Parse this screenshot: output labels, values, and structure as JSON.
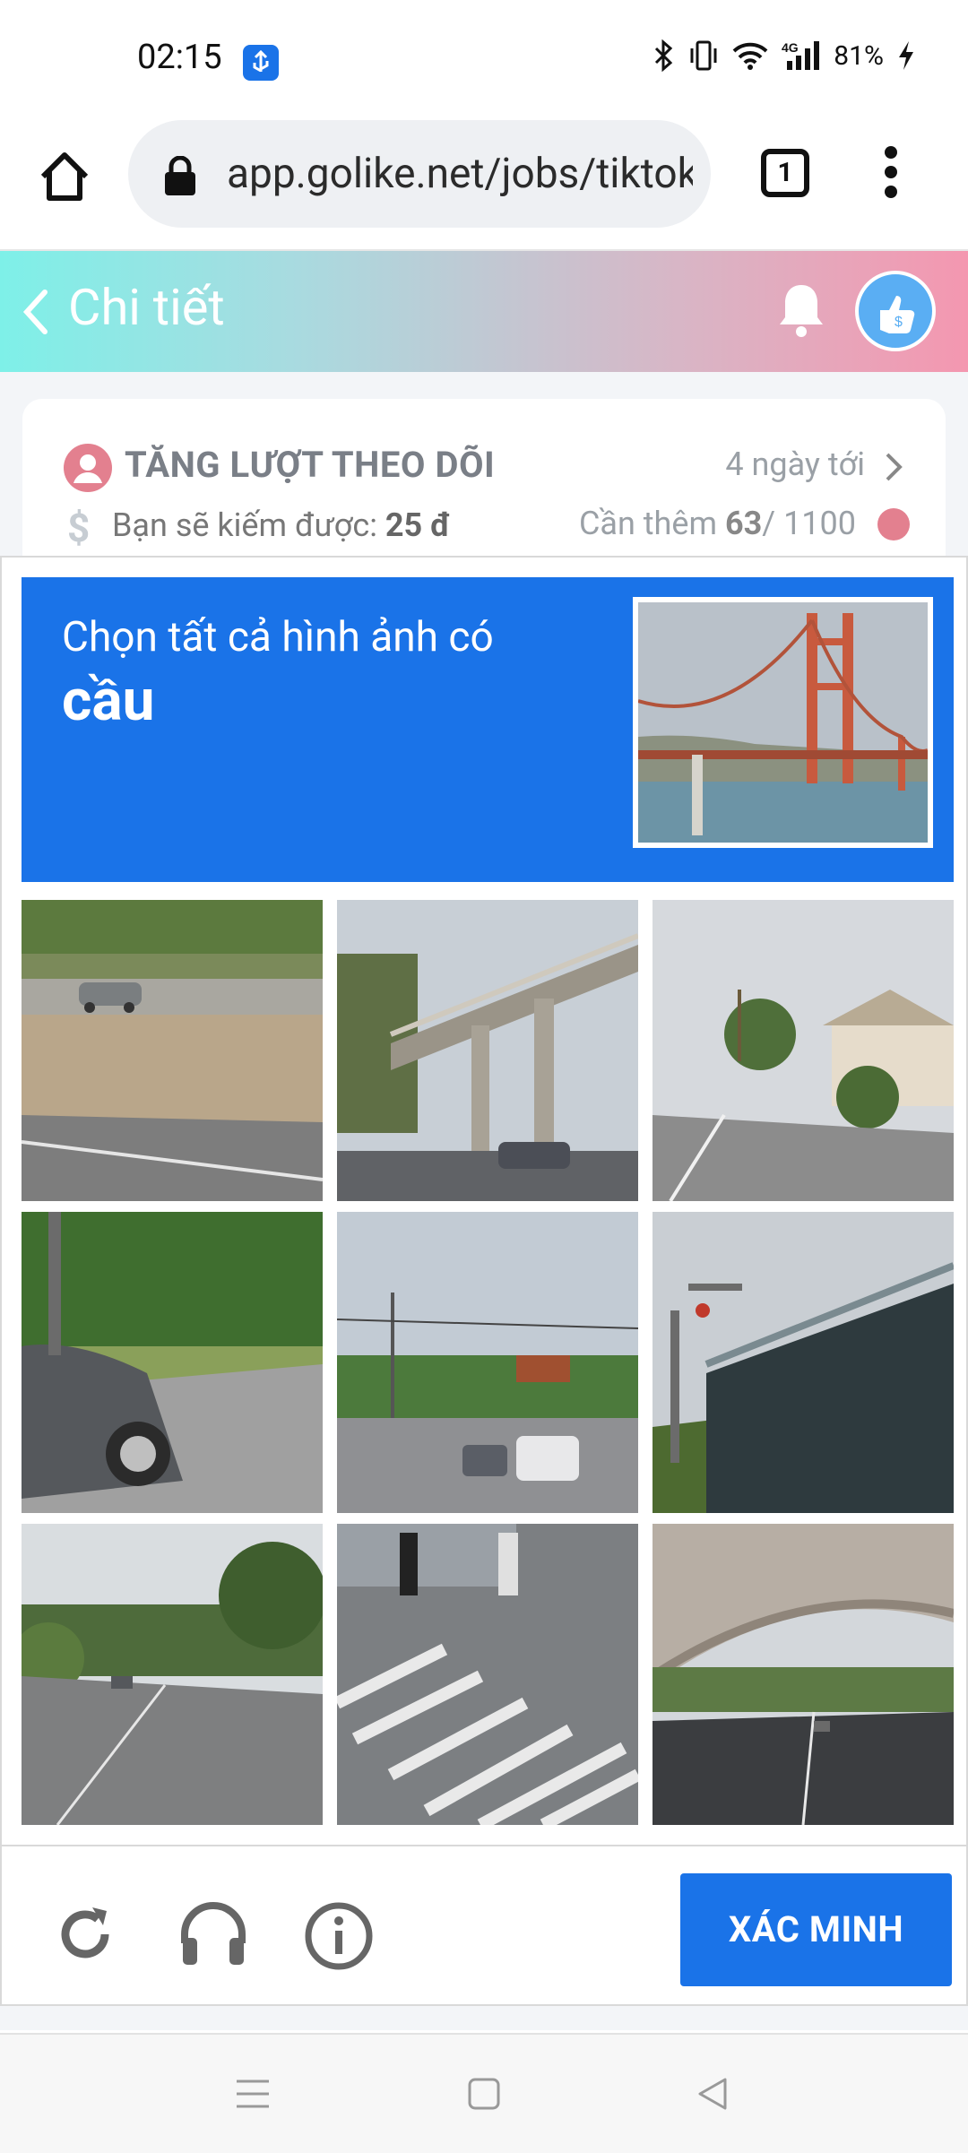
{
  "status_bar": {
    "time": "02:15",
    "battery_text": "81%",
    "network": "4G",
    "icons": [
      "usb-icon",
      "bluetooth-icon",
      "vibrate-icon",
      "wifi-icon",
      "signal-icon",
      "battery-charging-icon"
    ]
  },
  "browser": {
    "url": "app.golike.net/jobs/tiktok",
    "tab_count": "1"
  },
  "header": {
    "title": "Chi tiết"
  },
  "job": {
    "title": "TĂNG LƯỢT THEO DÕI",
    "deadline": "4 ngày tới",
    "earn_label": "Bạn sẽ kiếm được: ",
    "earn_value": "25 đ",
    "need_label": "Cần thêm ",
    "need_value": "63",
    "need_total": "/ 1100"
  },
  "captcha": {
    "instruction": "Chọn tất cả hình ảnh có",
    "keyword": "cầu",
    "verify_label": "XÁC MINH",
    "tiles": [
      {
        "scene": "road-with-car"
      },
      {
        "scene": "overpass-bridge"
      },
      {
        "scene": "street-palm-trees"
      },
      {
        "scene": "car-close-up"
      },
      {
        "scene": "intersection-traffic"
      },
      {
        "scene": "bridge-railing"
      },
      {
        "scene": "road-trees"
      },
      {
        "scene": "crosswalk-pedestrians"
      },
      {
        "scene": "highway-underpass"
      }
    ]
  },
  "colors": {
    "accent": "#1a73e8",
    "header_gradient_start": "#7ef0e8",
    "header_gradient_end": "#f497b0"
  }
}
